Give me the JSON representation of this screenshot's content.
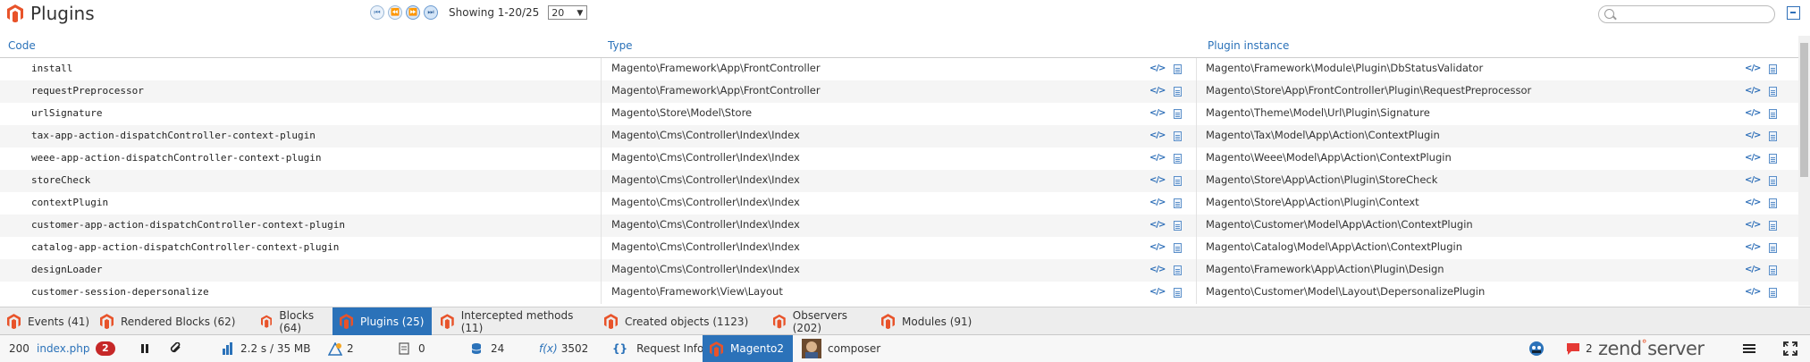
{
  "header": {
    "title": "Plugins",
    "showing": "Showing 1-20/25",
    "per_page": "20",
    "pager_buttons": [
      "first",
      "previous",
      "next",
      "last"
    ]
  },
  "table": {
    "columns": [
      "Code",
      "Type",
      "Plugin instance"
    ],
    "rows": [
      {
        "code": "install",
        "type": "Magento\\Framework\\App\\FrontController",
        "instance": "Magento\\Framework\\Module\\Plugin\\DbStatusValidator"
      },
      {
        "code": "requestPreprocessor",
        "type": "Magento\\Framework\\App\\FrontController",
        "instance": "Magento\\Store\\App\\FrontController\\Plugin\\RequestPreprocessor"
      },
      {
        "code": "urlSignature",
        "type": "Magento\\Store\\Model\\Store",
        "instance": "Magento\\Theme\\Model\\Url\\Plugin\\Signature"
      },
      {
        "code": "tax-app-action-dispatchController-context-plugin",
        "type": "Magento\\Cms\\Controller\\Index\\Index",
        "instance": "Magento\\Tax\\Model\\App\\Action\\ContextPlugin"
      },
      {
        "code": "weee-app-action-dispatchController-context-plugin",
        "type": "Magento\\Cms\\Controller\\Index\\Index",
        "instance": "Magento\\Weee\\Model\\App\\Action\\ContextPlugin"
      },
      {
        "code": "storeCheck",
        "type": "Magento\\Cms\\Controller\\Index\\Index",
        "instance": "Magento\\Store\\App\\Action\\Plugin\\StoreCheck"
      },
      {
        "code": "contextPlugin",
        "type": "Magento\\Cms\\Controller\\Index\\Index",
        "instance": "Magento\\Store\\App\\Action\\Plugin\\Context"
      },
      {
        "code": "customer-app-action-dispatchController-context-plugin",
        "type": "Magento\\Cms\\Controller\\Index\\Index",
        "instance": "Magento\\Customer\\Model\\App\\Action\\ContextPlugin"
      },
      {
        "code": "catalog-app-action-dispatchController-context-plugin",
        "type": "Magento\\Cms\\Controller\\Index\\Index",
        "instance": "Magento\\Catalog\\Model\\App\\Action\\ContextPlugin"
      },
      {
        "code": "designLoader",
        "type": "Magento\\Cms\\Controller\\Index\\Index",
        "instance": "Magento\\Framework\\App\\Action\\Plugin\\Design"
      },
      {
        "code": "customer-session-depersonalize",
        "type": "Magento\\Framework\\View\\Layout",
        "instance": "Magento\\Customer\\Model\\Layout\\DepersonalizePlugin"
      }
    ]
  },
  "tabs": [
    {
      "label": "Events (41)",
      "active": false
    },
    {
      "label": "Rendered Blocks (62)",
      "active": false
    },
    {
      "label": "Blocks (64)",
      "active": false
    },
    {
      "label": "Plugins (25)",
      "active": true
    },
    {
      "label": "Intercepted methods (11)",
      "active": false
    },
    {
      "label": "Created objects (1123)",
      "active": false
    },
    {
      "label": "Observers (202)",
      "active": false
    },
    {
      "label": "Modules (91)",
      "active": false
    }
  ],
  "statusbar": {
    "status_code": "200",
    "script": "index.php",
    "error_count": "2",
    "time_memory": "2.2 s / 35 MB",
    "warnings": "2",
    "logs": "0",
    "db_queries": "24",
    "functions_icon": "f(x)",
    "functions": "3502",
    "request_info_icon": "{}",
    "request_info": "Request Info",
    "magento": "Magento2",
    "composer": "composer",
    "notifications": "2",
    "brand_zend": "zend",
    "brand_server": "server"
  },
  "colors": {
    "accent": "#2b72b9",
    "magento_orange": "#e8532a",
    "error_badge": "#c62828"
  }
}
